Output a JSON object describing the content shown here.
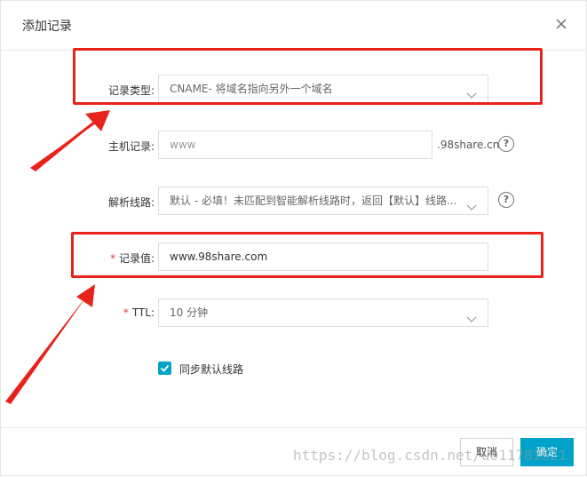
{
  "dialog": {
    "title": "添加记录",
    "close_icon": "close-icon"
  },
  "form": {
    "record_type": {
      "label": "记录类型:",
      "value": "CNAME- 将域名指向另外一个域名"
    },
    "host": {
      "label": "主机记录:",
      "placeholder": "www",
      "suffix": ".98share.cn",
      "help": "?"
    },
    "line": {
      "label": "解析线路:",
      "value": "默认 - 必填！未匹配到智能解析线路时，返回【默认】线路...",
      "help": "?"
    },
    "record_value": {
      "required_mark": "*",
      "label": "记录值:",
      "value": "www.98share.com"
    },
    "ttl": {
      "required_mark": "*",
      "label": "TTL:",
      "value": "10 分钟"
    },
    "sync": {
      "checked": true,
      "label": "同步默认线路"
    }
  },
  "footer": {
    "cancel_label": "取消",
    "ok_label": "确定"
  },
  "annotations": {
    "highlight_color": "#e8231b"
  },
  "watermark": "https://blog.csdn.net/u011781521",
  "colors": {
    "accent": "#00a2ca",
    "required": "#e4393c"
  }
}
